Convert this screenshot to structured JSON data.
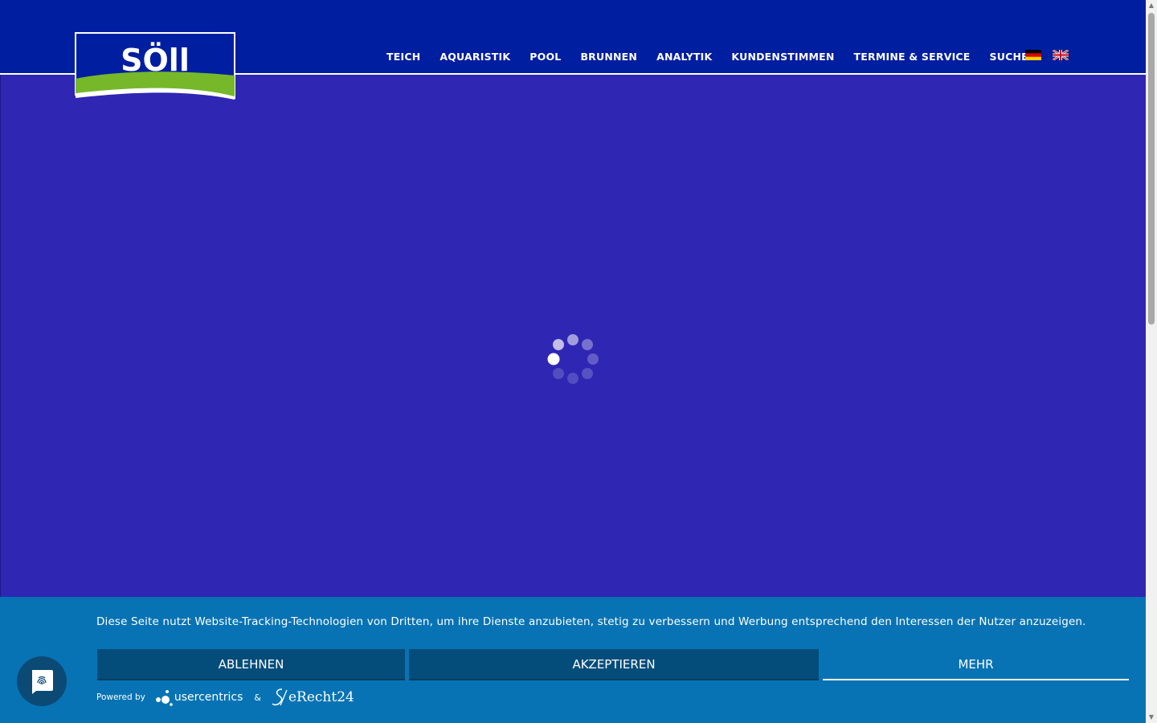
{
  "header": {
    "logo_text": "SÖll",
    "nav": [
      {
        "label": "TEICH"
      },
      {
        "label": "AQUARISTIK"
      },
      {
        "label": "POOL"
      },
      {
        "label": "BRUNNEN"
      },
      {
        "label": "ANALYTIK"
      },
      {
        "label": "KUNDENSTIMMEN"
      },
      {
        "label": "TERMINE & SERVICE"
      },
      {
        "label": "SUCHE"
      }
    ],
    "languages": [
      {
        "code": "de",
        "icon": "german-flag-icon"
      },
      {
        "code": "en",
        "icon": "uk-flag-icon"
      }
    ]
  },
  "main": {
    "state": "loading",
    "icon": "loading-spinner-icon"
  },
  "cookie_banner": {
    "text": "Diese Seite nutzt Website-Tracking-Technologien von Dritten, um ihre Dienste anzubieten, stetig zu verbessern und Werbung entsprechend den Interessen der Nutzer anzuzeigen.",
    "deny_label": "ABLEHNEN",
    "accept_label": "AKZEPTIEREN",
    "more_label": "MEHR",
    "powered_by": "Powered by",
    "provider_name": "usercentrics",
    "ampersand": "&",
    "partner_name": "eRecht24"
  },
  "colors": {
    "header_bg": "#001ea0",
    "main_bg": "#2f26b4",
    "banner_bg": "#0773b4",
    "button_bg": "#044d7a",
    "logo_green": "#76b82a"
  }
}
